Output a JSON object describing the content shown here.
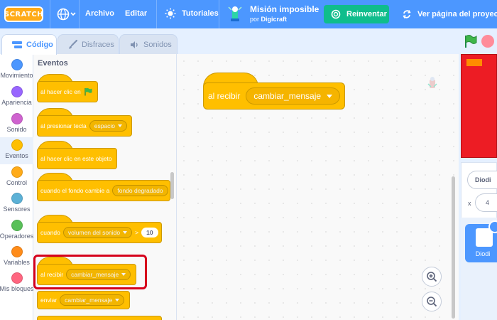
{
  "menubar": {
    "logo_text": "SCRATCH",
    "archivo": "Archivo",
    "editar": "Editar",
    "tutoriales": "Tutoriales",
    "project_title": "Misión imposible",
    "author_prefix": "por",
    "author_name": "Digicraft",
    "remix_label": "Reinventar",
    "see_project_label": "Ver página del proyecto"
  },
  "tabs": {
    "code": "Código",
    "costumes": "Disfraces",
    "sounds": "Sonidos"
  },
  "categories": [
    {
      "label": "Movimiento",
      "color": "#4c97ff"
    },
    {
      "label": "Apariencia",
      "color": "#9966ff"
    },
    {
      "label": "Sonido",
      "color": "#cf63cf"
    },
    {
      "label": "Eventos",
      "color": "#ffbf00"
    },
    {
      "label": "Control",
      "color": "#ffab19"
    },
    {
      "label": "Sensores",
      "color": "#5cb1d6"
    },
    {
      "label": "Operadores",
      "color": "#59c059"
    },
    {
      "label": "Variables",
      "color": "#ff8c1a"
    },
    {
      "label": "Mis bloques",
      "color": "#ff6680"
    }
  ],
  "palette": {
    "title": "Eventos",
    "blocks": {
      "flag_clicked": "al hacer clic en",
      "key_pressed": "al presionar tecla",
      "key_value": "espacio",
      "sprite_clicked": "al hacer clic en este objeto",
      "backdrop_switch": "cuando el fondo cambie a",
      "backdrop_value": "fondo degradado",
      "when_prefix": "cuando",
      "loudness_value": "volumen del sonido",
      "gt_symbol": ">",
      "threshold_value": "10",
      "receive_label": "al recibir",
      "receive_value": "cambiar_mensaje",
      "broadcast_label": "enviar",
      "broadcast_value": "cambiar_mensaje"
    }
  },
  "script": {
    "receive_label": "al recibir",
    "receive_value": "cambiar_mensaje"
  },
  "sprite_info": {
    "name": "Diodi",
    "x_label": "x",
    "x_value": "4",
    "tile_name": "Diodi"
  },
  "colors": {
    "menubar": "#4c97ff",
    "events_block": "#ffbf00",
    "remix_button": "#0fbd8c",
    "highlight_border": "#d6001c",
    "stage_background": "#ed1c24"
  }
}
